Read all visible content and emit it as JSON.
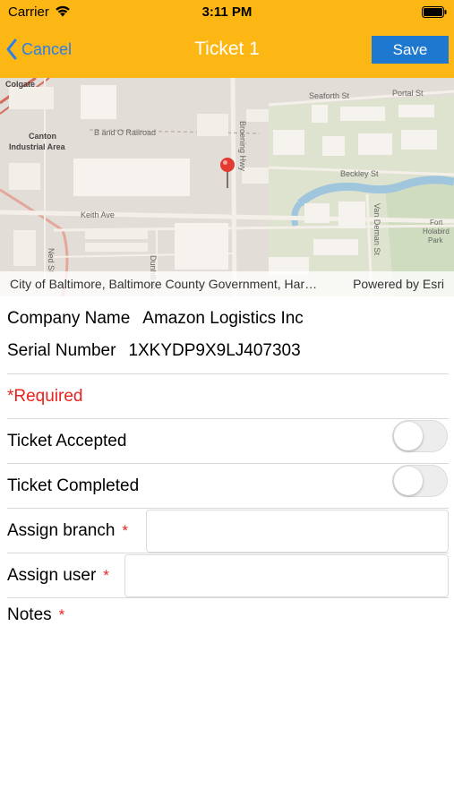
{
  "status_bar": {
    "carrier": "Carrier",
    "time": "3:11 PM"
  },
  "nav": {
    "back_label": "Cancel",
    "title": "Ticket 1",
    "save_label": "Save"
  },
  "map": {
    "labels": [
      "Colgate",
      "Seaforth St",
      "Portal St",
      "B and O Railroad",
      "Canton",
      "Industrial Area",
      "Broening Hwy",
      "Beckley St",
      "Keith Ave",
      "Van Deman St",
      "Fort",
      "Holabird",
      "Park",
      "Ned St",
      "Dunhill St"
    ],
    "attribution_left": "City of Baltimore, Baltimore County Government, Har…",
    "attribution_right": "Powered by Esri"
  },
  "info": {
    "company_label": "Company Name",
    "company_value": "Amazon Logistics Inc",
    "serial_label": "Serial Number",
    "serial_value": "1XKYDP9X9LJ407303"
  },
  "form": {
    "required_note": "*Required",
    "ticket_accepted_label": "Ticket Accepted",
    "ticket_accepted_on": false,
    "ticket_completed_label": "Ticket Completed",
    "ticket_completed_on": false,
    "assign_branch_label": "Assign branch",
    "assign_branch_value": "",
    "assign_user_label": "Assign user",
    "assign_user_value": "",
    "notes_label": "Notes",
    "required_marker": "*"
  },
  "colors": {
    "header": "#fcb714",
    "save_button": "#1e78d0",
    "back_link": "#2a7ff0",
    "required": "#e8221c"
  },
  "icons": [
    "wifi-icon",
    "battery-icon",
    "chevron-left-icon",
    "map-pin-icon"
  ]
}
